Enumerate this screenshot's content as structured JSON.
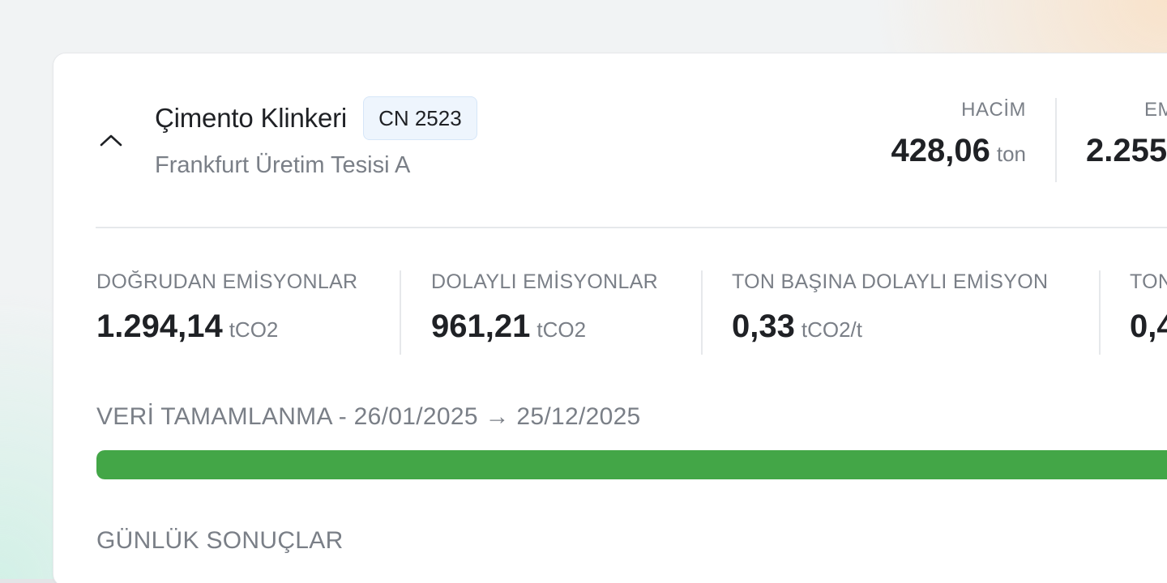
{
  "product": {
    "title": "Çimento Klinkeri",
    "cn_code": "CN 2523",
    "facility": "Frankfurt Üretim Tesisi A",
    "expanded": true
  },
  "header_stats": {
    "volume": {
      "label": "HACİM",
      "value": "428,06",
      "unit": "ton"
    },
    "emissions": {
      "label": "EM",
      "value": "2.255"
    }
  },
  "metrics": [
    {
      "label": "DOĞRUDAN EMİSYONLAR",
      "value": "1.294,14",
      "unit": "tCO2"
    },
    {
      "label": "DOLAYLI EMİSYONLAR",
      "value": "961,21",
      "unit": "tCO2"
    },
    {
      "label": "TON BAŞINA DOLAYLI EMİSYON",
      "value": "0,33",
      "unit": "tCO2/t"
    },
    {
      "label": "TON",
      "value": "0,4",
      "unit": ""
    }
  ],
  "completion": {
    "label": "VERİ TAMAMLANMA - 26/01/2025 → 25/12/2025",
    "percent": 100,
    "color": "#43a647"
  },
  "daily_results": {
    "label": "GÜNLÜK SONUÇLAR"
  },
  "icons": {
    "collapse": "chevron-up-icon"
  }
}
